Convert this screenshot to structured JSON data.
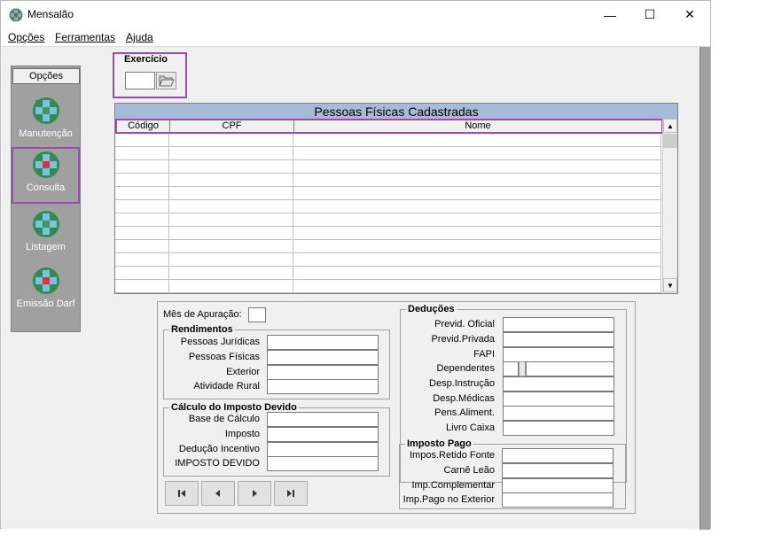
{
  "window": {
    "title": "Mensalão",
    "controls": {
      "minimize": "—",
      "maximize": "☐",
      "close": "✕"
    }
  },
  "menu": {
    "items": [
      {
        "label": "Opções"
      },
      {
        "label": "Ferramentas"
      },
      {
        "label": "Ajuda"
      }
    ]
  },
  "sidebar": {
    "header": "Opções",
    "items": [
      {
        "label": "Manutenção",
        "icon": "globe-icon",
        "selected": false
      },
      {
        "label": "Consulta",
        "icon": "globe-icon",
        "selected": true
      },
      {
        "label": "Listagem",
        "icon": "globe-icon",
        "selected": false
      },
      {
        "label": "Emissão Darf",
        "icon": "globe-icon",
        "selected": false
      }
    ]
  },
  "exercicio": {
    "label": "Exercício",
    "value": "",
    "open_icon": "folder-open-icon"
  },
  "grid": {
    "title": "Pessoas Físicas Cadastradas",
    "columns": [
      "Código",
      "CPF",
      "Nome"
    ],
    "rows": []
  },
  "form": {
    "mes_apuracao": {
      "label": "Mês de Apuração:",
      "value": ""
    },
    "rendimentos": {
      "title": "Rendimentos",
      "fields": [
        {
          "label": "Pessoas Jurídicas",
          "value": ""
        },
        {
          "label": "Pessoas Físicas",
          "value": ""
        },
        {
          "label": "Exterior",
          "value": ""
        },
        {
          "label": "Atividade Rural",
          "value": ""
        }
      ]
    },
    "calculo": {
      "title": "Cálculo do Imposto Devido",
      "fields": [
        {
          "label": "Base de Cálculo",
          "value": ""
        },
        {
          "label": "Imposto",
          "value": ""
        },
        {
          "label": "Dedução Incentivo",
          "value": ""
        },
        {
          "label": "IMPOSTO DEVIDO",
          "value": ""
        }
      ]
    },
    "deducoes": {
      "title": "Deduções",
      "fields": [
        {
          "label": "Previd. Oficial",
          "value": ""
        },
        {
          "label": "Previd.Privada",
          "value": ""
        },
        {
          "label": "FAPI",
          "value": ""
        },
        {
          "label": "Dependentes",
          "value": ""
        },
        {
          "label": "Desp.Instrução",
          "value": ""
        },
        {
          "label": "Desp.Médicas",
          "value": ""
        },
        {
          "label": "Pens.Aliment.",
          "value": ""
        },
        {
          "label": "Livro Caixa",
          "value": ""
        }
      ]
    },
    "imposto_pago": {
      "title": "Imposto Pago",
      "fields": [
        {
          "label": "Impos.Retido  Fonte",
          "value": ""
        },
        {
          "label": "Carnê Leão",
          "value": ""
        },
        {
          "label": "Imp.Complementar",
          "value": ""
        },
        {
          "label": "Imp.Pago no Exterior",
          "value": ""
        }
      ]
    }
  },
  "navigation": {
    "first": "first-record-icon",
    "prev": "previous-record-icon",
    "next": "next-record-icon",
    "last": "last-record-icon"
  },
  "colors": {
    "highlight": "#9b4cb3",
    "grid_title_bg": "#a6bbd7",
    "sidebar_bg": "#a0a0a0"
  }
}
